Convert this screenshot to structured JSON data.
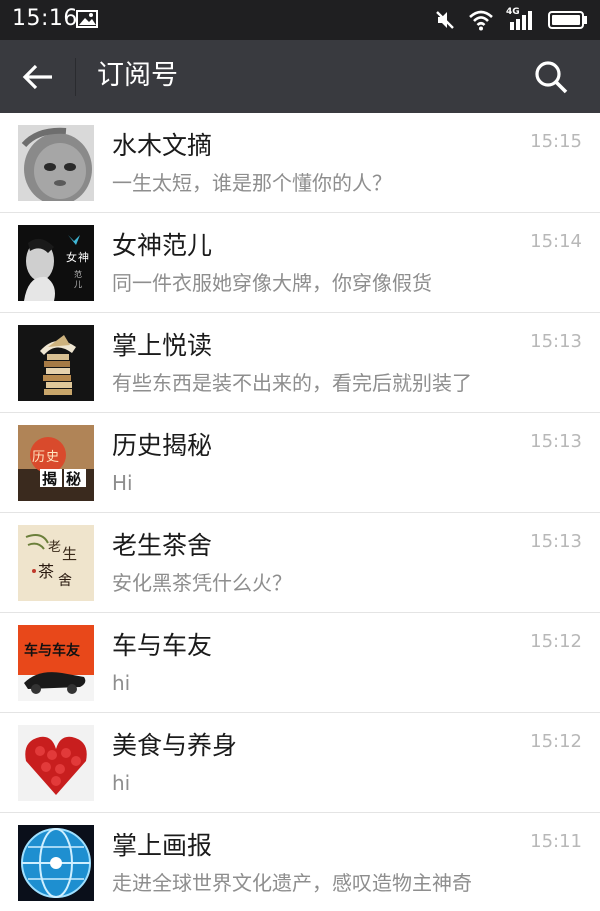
{
  "status_bar": {
    "time": "15:16",
    "network": "4G",
    "icons": [
      "photo-icon",
      "mute-icon",
      "wifi-icon",
      "signal-icon",
      "battery-icon"
    ]
  },
  "header": {
    "title": "订阅号",
    "icons": [
      "back-arrow-icon",
      "search-icon"
    ],
    "background": "#393a3f"
  },
  "subscriptions": [
    {
      "name": "水木文摘",
      "preview": "一生太短，谁是那个懂你的人？",
      "time": "15:15"
    },
    {
      "name": "女神范儿",
      "preview": "同一件衣服她穿像大牌，你穿像假货",
      "time": "15:14",
      "avatar_text": [
        "女",
        "神",
        "范",
        "儿"
      ]
    },
    {
      "name": "掌上悦读",
      "preview": "有些东西是装不出来的，看完后就别装了",
      "time": "15:13"
    },
    {
      "name": "历史揭秘",
      "preview": "Hi",
      "time": "15:13",
      "avatar_text": [
        "历",
        "史",
        "揭",
        "秘"
      ]
    },
    {
      "name": "老生茶舍",
      "preview": "安化黑茶凭什么火？",
      "time": "15:13",
      "avatar_text": [
        "老",
        "生",
        "茶",
        "舍"
      ]
    },
    {
      "name": "车与车友",
      "preview": "hi",
      "time": "15:12",
      "avatar_text": [
        "车与车友"
      ]
    },
    {
      "name": "美食与养身",
      "preview": "hi",
      "time": "15:12"
    },
    {
      "name": "掌上画报",
      "preview": "走进全球世界文化遗产，感叹造物主神奇",
      "time": "15:11"
    }
  ]
}
